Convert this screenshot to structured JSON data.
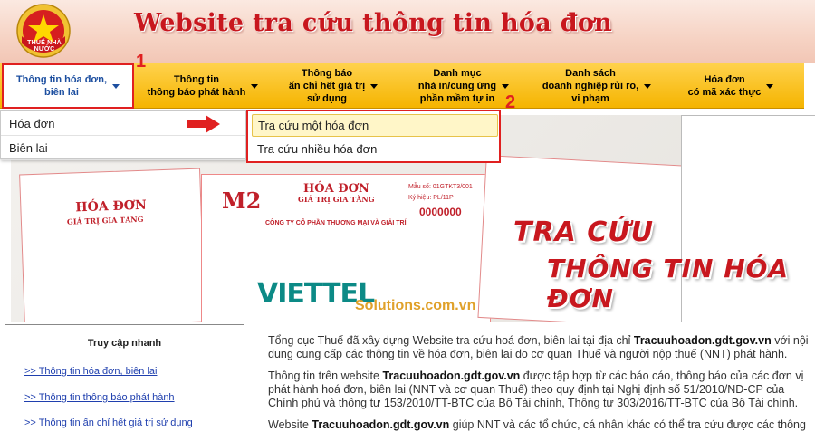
{
  "header": {
    "emblem_label": "THUẾ NHÀ NƯỚC",
    "site_title": "Website tra cứu thông tin hóa đơn"
  },
  "nav": {
    "items": [
      {
        "line1": "Thông tin hóa đơn,",
        "line2": "biên lai",
        "line3": ""
      },
      {
        "line1": "Thông tin",
        "line2": "thông báo phát hành",
        "line3": ""
      },
      {
        "line1": "Thông báo",
        "line2": "ấn chỉ hết giá trị",
        "line3": "sử dụng"
      },
      {
        "line1": "Danh mục",
        "line2": "nhà in/cung ứng",
        "line3": "phần mềm tự in"
      },
      {
        "line1": "Danh sách",
        "line2": "doanh nghiệp rủi ro,",
        "line3": "vi phạm"
      },
      {
        "line1": "Hóa đơn",
        "line2": "có mã xác thực",
        "line3": ""
      }
    ]
  },
  "annotations": {
    "step1": "1",
    "step2": "2"
  },
  "dropdown": {
    "items": [
      "Hóa đơn",
      "Biên lai"
    ],
    "submenu": [
      "Tra cứu một hóa đơn",
      "Tra cứu nhiều hóa đơn"
    ]
  },
  "banner": {
    "line1": "TRA CỨU",
    "line2": "THÔNG TIN HÓA ĐƠN",
    "sheet_title_main": "HÓA ĐƠN",
    "sheet_sub": "GIÁ TRỊ GIA TĂNG",
    "sheet_m2": "M2",
    "sheet_code": "Mẫu số: 01GTKT3/001",
    "sheet_symbol": "Ký hiệu: PL/11P",
    "sheet_number": "0000000",
    "sheet_company": "CÔNG TY CỔ PHẦN THƯƠNG MẠI VÀ GIẢI TRÍ",
    "viettel": "VIETTEL",
    "solutions": "Solutions.com.vn"
  },
  "quick_access": {
    "title": "Truy cập nhanh",
    "links": [
      ">> Thông tin hóa đơn, biên lai",
      ">> Thông tin thông báo phát hành",
      ">> Thông tin ấn chỉ hết giá trị sử dụng"
    ]
  },
  "content": {
    "p1_a": "Tổng cục Thuế đã xây dựng Website tra cứu hoá đơn, biên lai tại địa chỉ ",
    "p1_b": "Tracuuhoadon.gdt.gov.vn",
    "p1_c": " với nội dung cung cấp các thông tin về hóa đơn, biên lai do cơ quan Thuế và người nộp thuế (NNT) phát hành.",
    "p2_a": "Thông tin trên website ",
    "p2_b": "Tracuuhoadon.gdt.gov.vn",
    "p2_c": " được tập hợp từ các báo cáo, thông báo của các đơn vị phát hành hoá đơn, biên lai (NNT và cơ quan Thuế) theo quy định tại Nghị định số 51/2010/NĐ-CP của Chính phủ và thông tư 153/2010/TT-BTC của Bộ Tài chính, Thông tư 303/2016/TT-BTC của Bộ Tài chính.",
    "p3_a": "Website ",
    "p3_b": "Tracuuhoadon.gdt.gov.vn",
    "p3_c": " giúp NNT và các tổ chức, cá nhân khác có thể tra cứu được các thông"
  }
}
